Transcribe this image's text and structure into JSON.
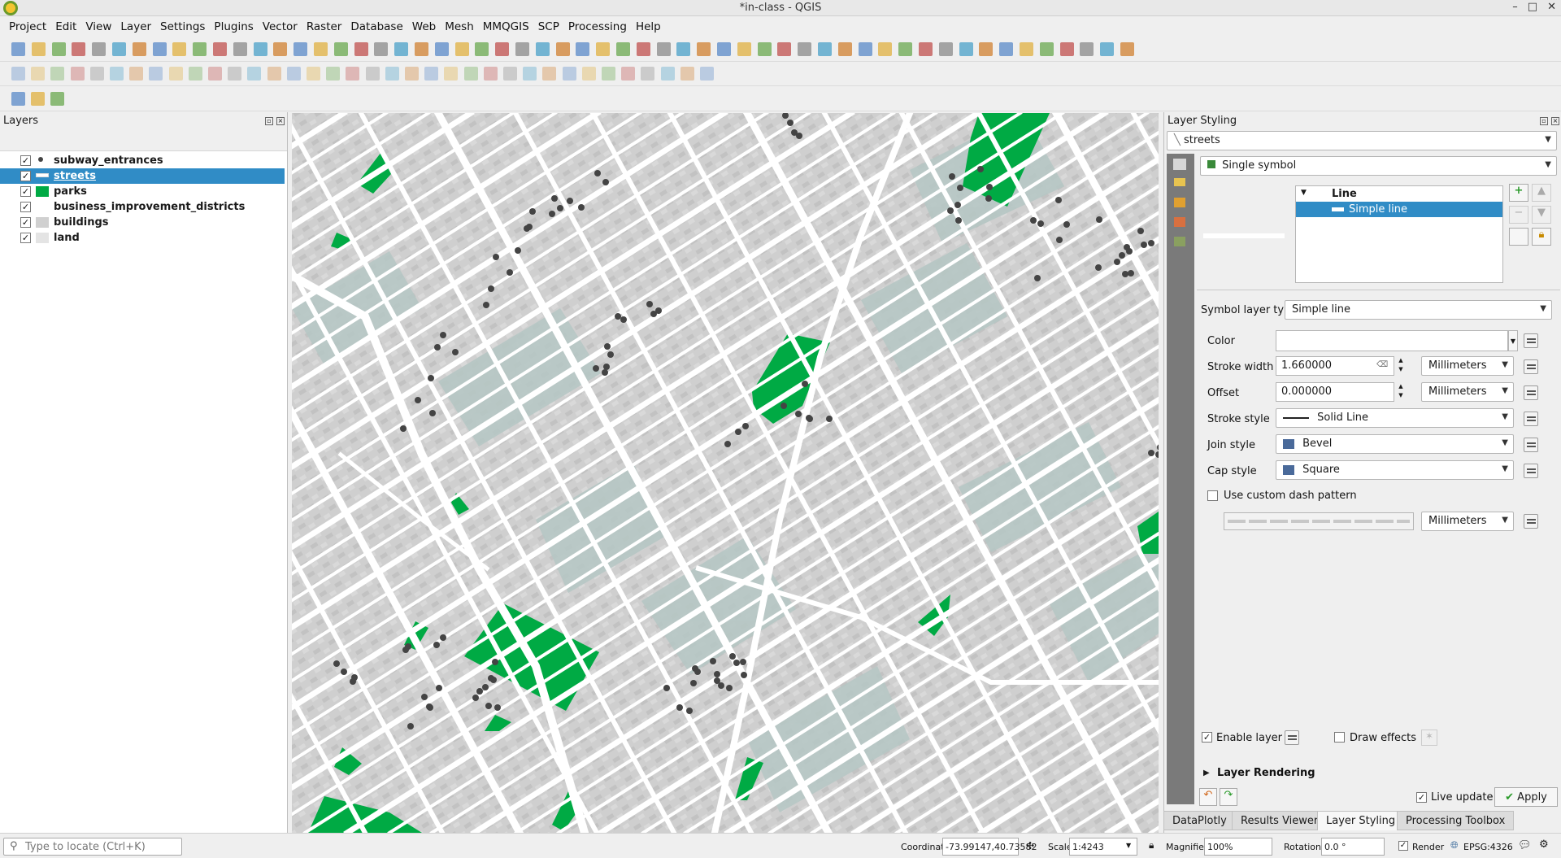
{
  "window": {
    "title": "*in-class - QGIS"
  },
  "menu": [
    "Project",
    "Edit",
    "View",
    "Layer",
    "Settings",
    "Plugins",
    "Vector",
    "Raster",
    "Database",
    "Web",
    "Mesh",
    "MMQGIS",
    "SCP",
    "Processing",
    "Help"
  ],
  "layers_panel": {
    "title": "Layers",
    "layers": [
      {
        "name": "subway_entrances",
        "checked": "✓"
      },
      {
        "name": "streets",
        "checked": "✓"
      },
      {
        "name": "parks",
        "checked": "✓"
      },
      {
        "name": "business_improvement_districts",
        "checked": "✓"
      },
      {
        "name": "buildings",
        "checked": "✓"
      },
      {
        "name": "land",
        "checked": "✓"
      }
    ]
  },
  "styling": {
    "title": "Layer Styling",
    "layer_combo": "streets",
    "renderer": "Single symbol",
    "tree_root": "Line",
    "tree_child": "Simple line",
    "symbol_layer_type_label": "Symbol layer type",
    "symbol_layer_type": "Simple line",
    "color_label": "Color",
    "stroke_width_label": "Stroke width",
    "stroke_width": "1.660000",
    "stroke_width_unit": "Millimeters",
    "offset_label": "Offset",
    "offset": "0.000000",
    "offset_unit": "Millimeters",
    "stroke_style_label": "Stroke style",
    "stroke_style": "Solid Line",
    "join_style_label": "Join style",
    "join_style": "Bevel",
    "cap_style_label": "Cap style",
    "cap_style": "Square",
    "custom_dash_label": "Use custom dash pattern",
    "dash_unit": "Millimeters",
    "enable_layer_label": "Enable layer",
    "draw_effects_label": "Draw effects",
    "layer_rendering_label": "Layer Rendering",
    "live_update_label": "Live update",
    "apply_label": "Apply"
  },
  "bottom_tabs": [
    "DataPlotly",
    "Results Viewer",
    "Layer Styling",
    "Processing Toolbox"
  ],
  "status": {
    "locate_placeholder": "Type to locate (Ctrl+K)",
    "coordinate_label": "Coordinate",
    "coordinate": "-73.99147,40.73582",
    "scale_label": "Scale",
    "scale": "1:4243",
    "magnifier_label": "Magnifier",
    "magnifier": "100%",
    "rotation_label": "Rotation",
    "rotation": "0.0 °",
    "render_label": "Render",
    "crs": "EPSG:4326"
  },
  "colors": {
    "park": "#00aa44",
    "street": "#ffffff",
    "building": "#d0d0d0",
    "bid": "#b8c9c6",
    "selection": "#308cc6"
  }
}
